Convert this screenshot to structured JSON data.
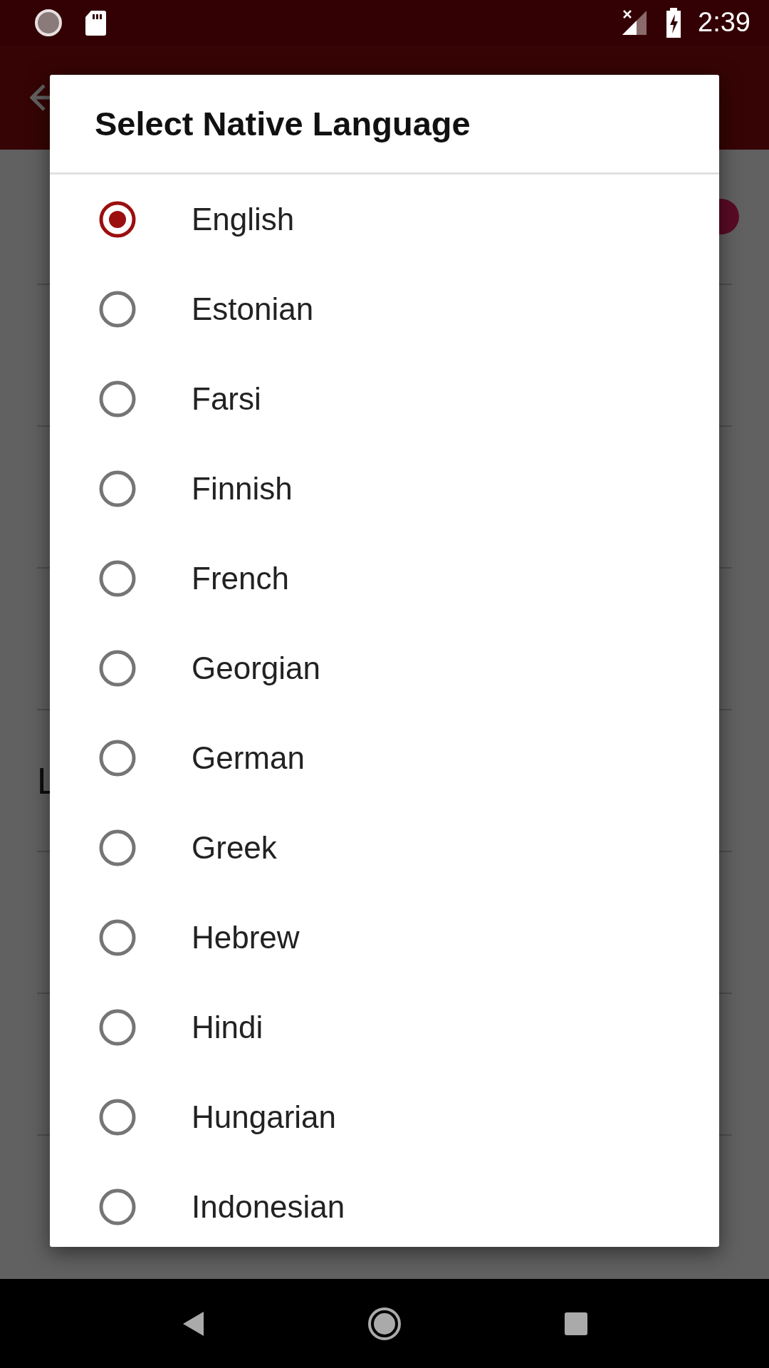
{
  "status_bar": {
    "time": "2:39"
  },
  "page": {
    "rows": [
      {
        "kind": "switch"
      },
      {
        "kind": "plain"
      },
      {
        "kind": "plain"
      },
      {
        "kind": "plain"
      },
      {
        "label": "L",
        "kind": "plain"
      },
      {
        "kind": "plain"
      },
      {
        "kind": "plain"
      }
    ]
  },
  "dialog": {
    "title": "Select Native Language",
    "options": [
      {
        "label": "English",
        "selected": true
      },
      {
        "label": "Estonian",
        "selected": false
      },
      {
        "label": "Farsi",
        "selected": false
      },
      {
        "label": "Finnish",
        "selected": false
      },
      {
        "label": "French",
        "selected": false
      },
      {
        "label": "Georgian",
        "selected": false
      },
      {
        "label": "German",
        "selected": false
      },
      {
        "label": "Greek",
        "selected": false
      },
      {
        "label": "Hebrew",
        "selected": false
      },
      {
        "label": "Hindi",
        "selected": false
      },
      {
        "label": "Hungarian",
        "selected": false
      },
      {
        "label": "Indonesian",
        "selected": false
      }
    ]
  }
}
